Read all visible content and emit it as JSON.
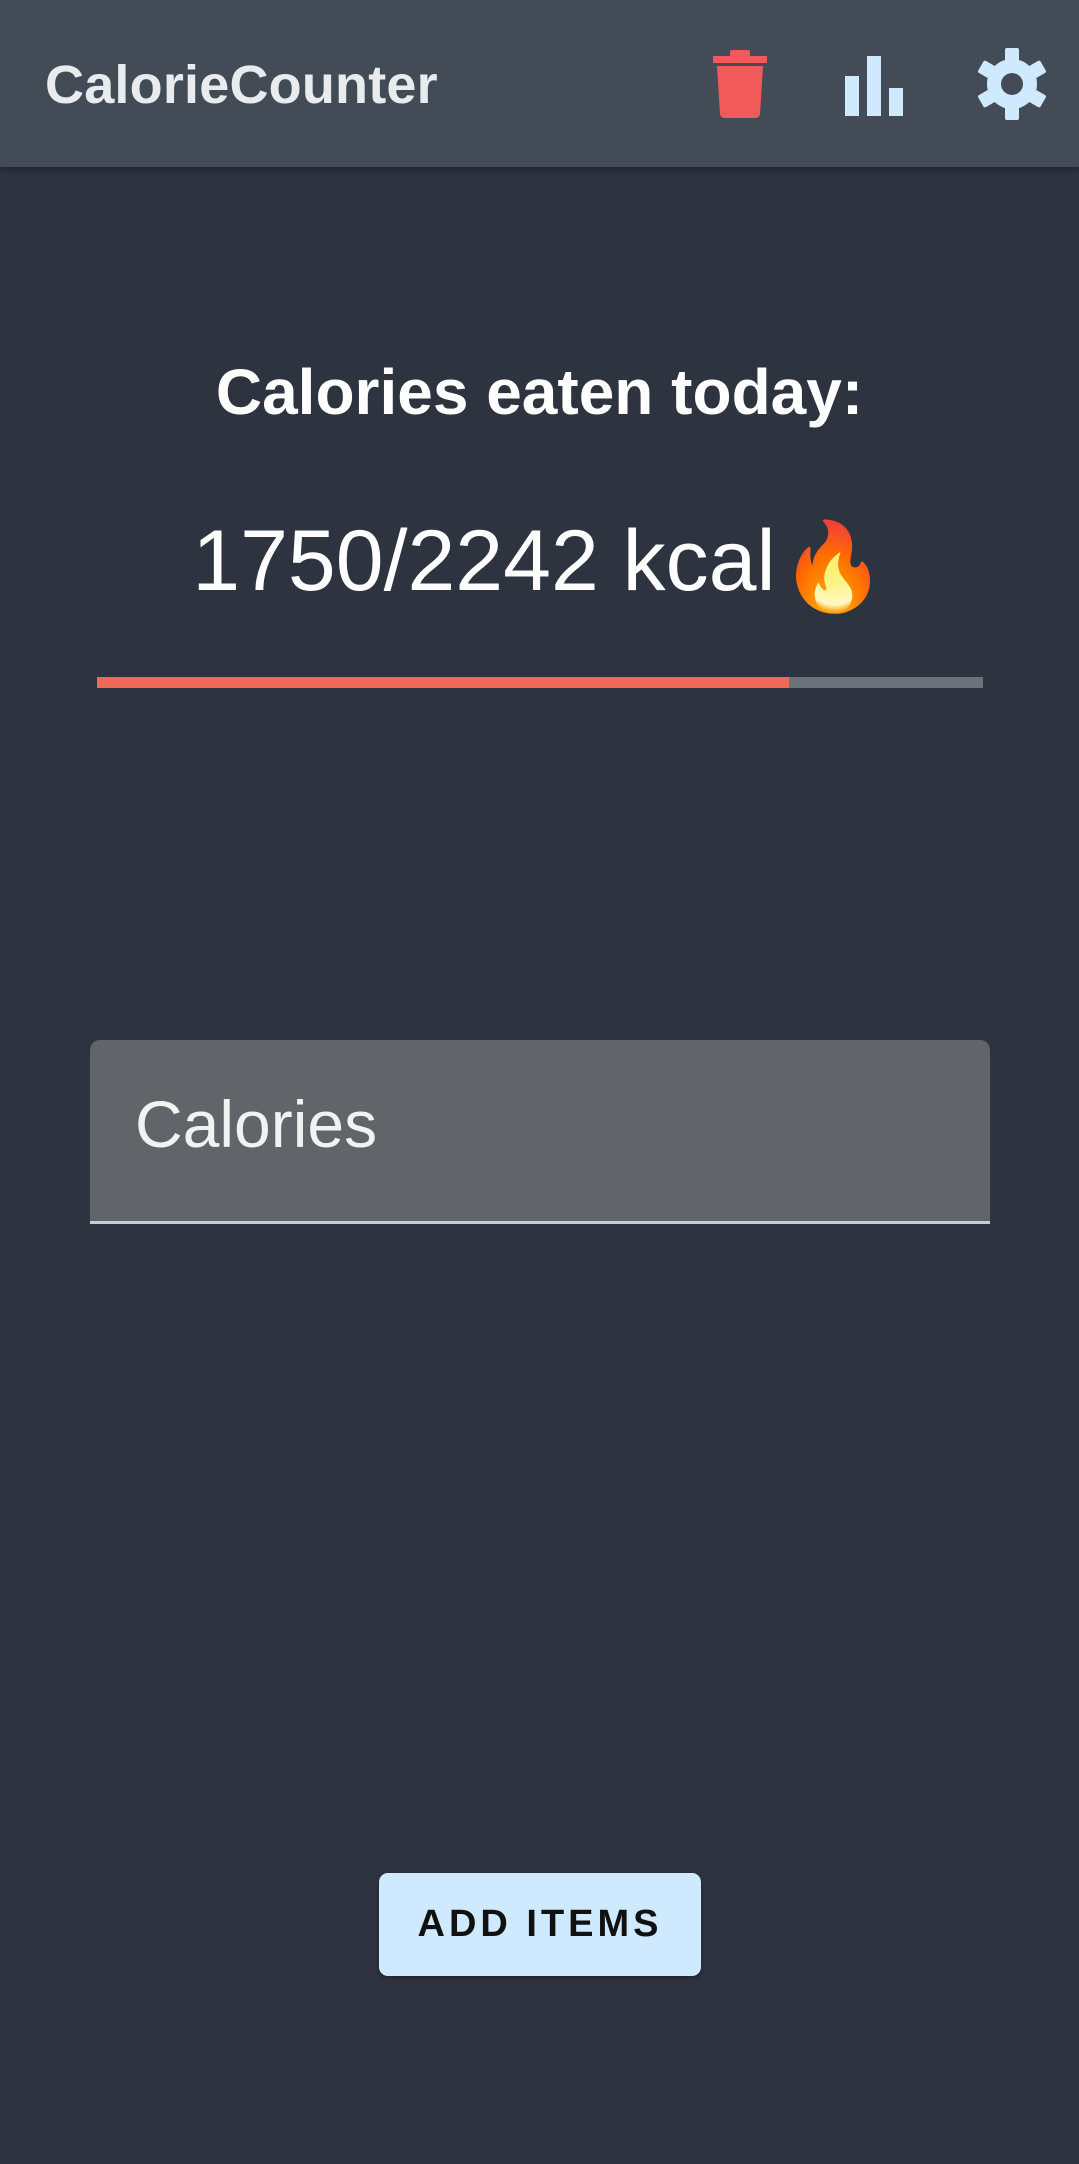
{
  "app_bar": {
    "title": "CalorieCounter",
    "actions": [
      {
        "name": "delete",
        "icon": "trash-icon",
        "color": "#f05a5a"
      },
      {
        "name": "statistics",
        "icon": "bar-chart-icon",
        "color": "#cfe9ff"
      },
      {
        "name": "settings",
        "icon": "gear-icon",
        "color": "#cfe9ff"
      }
    ]
  },
  "summary": {
    "heading": "Calories eaten today:",
    "count_text": "1750/2242 kcal",
    "emoji": "🔥",
    "eaten": 1750,
    "goal": 2242,
    "progress_fraction": 0.781,
    "progress_color": "#ec6a57",
    "track_color": "#6c727c"
  },
  "input": {
    "placeholder": "Calories",
    "value": ""
  },
  "actions": {
    "add_items_label": "ADD ITEMS"
  },
  "colors": {
    "background": "#2e3340",
    "app_bar": "#434c56",
    "button": "#cfe9ff"
  }
}
